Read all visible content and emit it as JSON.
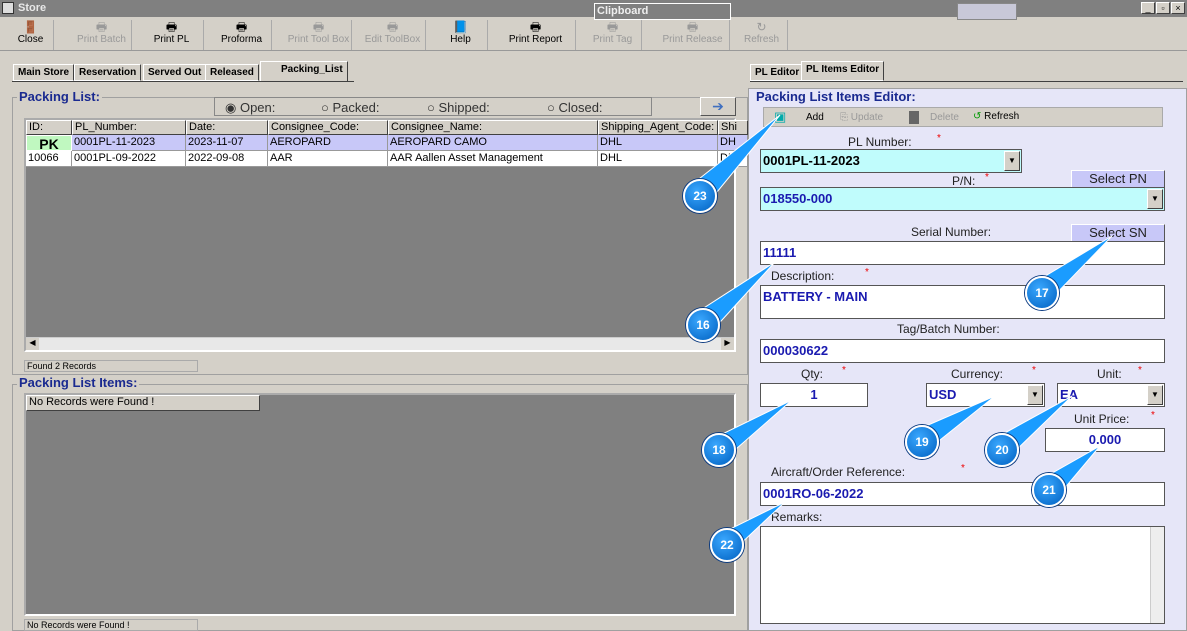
{
  "window": {
    "title": "Store",
    "clipboard": "Clipboard"
  },
  "toolbar": [
    {
      "label": "Close",
      "icon": "door-icon",
      "enabled": true
    },
    {
      "label": "Print Batch",
      "icon": "printer-icon",
      "enabled": false
    },
    {
      "label": "Print PL",
      "icon": "printer-icon",
      "enabled": true
    },
    {
      "label": "Proforma",
      "icon": "printer-icon",
      "enabled": true
    },
    {
      "label": "Print Tool Box",
      "icon": "printer-icon",
      "enabled": false
    },
    {
      "label": "Edit ToolBox",
      "icon": "printer-icon",
      "enabled": false
    },
    {
      "label": "Help",
      "icon": "help-book-icon",
      "enabled": true
    },
    {
      "label": "Print Report",
      "icon": "printer-icon",
      "enabled": true
    },
    {
      "label": "Print Tag",
      "icon": "printer-icon",
      "enabled": false
    },
    {
      "label": "Print Release",
      "icon": "printer-icon",
      "enabled": false
    },
    {
      "label": "Refresh",
      "icon": "refresh-icon",
      "enabled": false
    }
  ],
  "tabs": [
    "Main Store",
    "Reservation",
    "Served Out",
    "Released",
    "Packing_List"
  ],
  "right_tabs": [
    "PL Editor",
    "PL Items Editor"
  ],
  "packing_list": {
    "title": "Packing List:",
    "filters": [
      "Open:",
      "Packed:",
      "Shipped:",
      "Closed:"
    ],
    "selected_filter": "Open:",
    "columns": [
      "ID:",
      "PL_Number:",
      "Date:",
      "Consignee_Code:",
      "Consignee_Name:",
      "Shipping_Agent_Code:",
      "Shi"
    ],
    "rows": [
      [
        "PK",
        "0001PL-11-2023",
        "2023-11-07",
        "AEROPARD",
        "AEROPARD CAMO",
        "DHL",
        "DH"
      ],
      [
        "10066",
        "0001PL-09-2022",
        "2022-09-08",
        "AAR",
        "AAR Aallen Asset Management",
        "DHL",
        "DH"
      ]
    ],
    "status": "Found 2 Records"
  },
  "items": {
    "title": "Packing List Items:",
    "empty": "No Records were Found !",
    "status": "No Records were Found !"
  },
  "editor": {
    "title": "Packing List Items Editor:",
    "toolbar": {
      "add": "Add",
      "update": "Update",
      "delete": "Delete",
      "refresh": "Refresh"
    },
    "pl_number_label": "PL Number:",
    "pl_number": "0001PL-11-2023",
    "pn_label": "P/N:",
    "pn": "018550-000",
    "select_pn": "Select PN",
    "sn_label": "Serial Number:",
    "sn": "11111",
    "select_sn": "Select SN",
    "desc_label": "Description:",
    "desc": "BATTERY - MAIN",
    "tag_label": "Tag/Batch Number:",
    "tag": "000030622",
    "qty_label": "Qty:",
    "qty": "1",
    "currency_label": "Currency:",
    "currency": "USD",
    "unit_label": "Unit:",
    "unit": "EA",
    "price_label": "Unit Price:",
    "price": "0.000",
    "ref_label": "Aircraft/Order Reference:",
    "ref": "0001RO-06-2022",
    "remarks_label": "Remarks:",
    "remarks": "",
    "req": "*"
  },
  "callouts": [
    "23",
    "16",
    "17",
    "18",
    "19",
    "20",
    "21",
    "22"
  ]
}
